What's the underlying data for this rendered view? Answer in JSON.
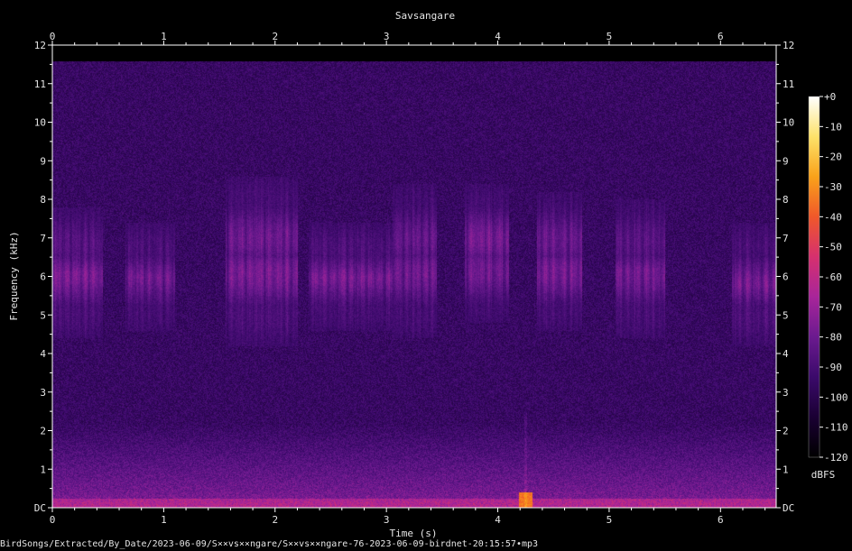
{
  "title": "Savsangare",
  "footer_path": "BirdSongs/Extracted/By_Date/2023-06-09/S××vs××ngare/S××vs××ngare-76-2023-06-09-birdnet-20:15:57•mp3",
  "chart_data": {
    "type": "heatmap",
    "title": "Savsangare",
    "xlabel": "Time (s)",
    "ylabel": "Frequency (kHz)",
    "xlim": [
      0,
      6.5
    ],
    "ylim": [
      0,
      12
    ],
    "x_ticks": [
      "0",
      "1",
      "2",
      "3",
      "4",
      "5",
      "6"
    ],
    "y_ticks": [
      "DC",
      "1",
      "2",
      "3",
      "4",
      "5",
      "6",
      "7",
      "8",
      "9",
      "10",
      "11",
      "12"
    ],
    "colorbar": {
      "label": "dBFS",
      "ticks": [
        "+0",
        "-10",
        "-20",
        "-30",
        "-40",
        "-50",
        "-60",
        "-70",
        "-80",
        "-90",
        "-100",
        "-110",
        "-120"
      ],
      "range": [
        -120,
        0
      ],
      "colormap": [
        "#000000",
        "#1a0033",
        "#3b0a6b",
        "#6b1a8f",
        "#a8259a",
        "#d6306e",
        "#f0582a",
        "#f9a21a",
        "#fde26a",
        "#ffffff"
      ]
    },
    "background_color": "#000000",
    "noise_floor_dbfs": -95,
    "max_frequency_khz": 11.6,
    "bursts": [
      {
        "t_start": 0.0,
        "t_end": 0.45,
        "f_low": 4.4,
        "f_high": 7.8,
        "peak_dbfs": -72
      },
      {
        "t_start": 0.65,
        "t_end": 1.1,
        "f_low": 4.6,
        "f_high": 7.4,
        "peak_dbfs": -76
      },
      {
        "t_start": 1.55,
        "t_end": 2.2,
        "f_low": 4.2,
        "f_high": 8.6,
        "peak_dbfs": -70
      },
      {
        "t_start": 2.3,
        "t_end": 3.05,
        "f_low": 4.6,
        "f_high": 7.4,
        "peak_dbfs": -74
      },
      {
        "t_start": 3.05,
        "t_end": 3.45,
        "f_low": 4.4,
        "f_high": 8.4,
        "peak_dbfs": -72
      },
      {
        "t_start": 3.7,
        "t_end": 4.1,
        "f_low": 4.8,
        "f_high": 8.4,
        "peak_dbfs": -68
      },
      {
        "t_start": 4.35,
        "t_end": 4.75,
        "f_low": 4.6,
        "f_high": 8.2,
        "peak_dbfs": -70
      },
      {
        "t_start": 5.05,
        "t_end": 5.5,
        "f_low": 4.4,
        "f_high": 8.0,
        "peak_dbfs": -74
      },
      {
        "t_start": 6.1,
        "t_end": 6.5,
        "f_low": 4.2,
        "f_high": 7.4,
        "peak_dbfs": -74
      }
    ],
    "transient": {
      "t": 4.25,
      "f_low": 0,
      "f_high": 0.4,
      "peak_dbfs": -35
    }
  }
}
